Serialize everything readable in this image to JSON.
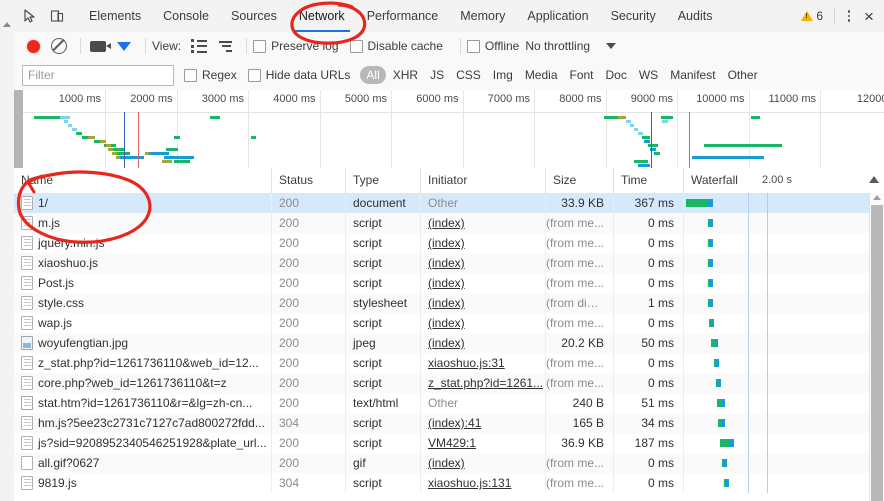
{
  "window": {
    "warning_count": "6",
    "close_label": "×"
  },
  "tabbar": {
    "inspect_icon": "inspect-cursor-icon",
    "device_icon": "device-toolbar-icon",
    "tabs": [
      {
        "label": "Elements",
        "active": false
      },
      {
        "label": "Console",
        "active": false
      },
      {
        "label": "Sources",
        "active": false
      },
      {
        "label": "Network",
        "active": true
      },
      {
        "label": "Performance",
        "active": false
      },
      {
        "label": "Memory",
        "active": false
      },
      {
        "label": "Application",
        "active": false
      },
      {
        "label": "Security",
        "active": false
      },
      {
        "label": "Audits",
        "active": false
      }
    ]
  },
  "toolbar": {
    "record_icon": "record-icon",
    "clear_icon": "clear-icon",
    "camera_icon": "camera-icon",
    "filter_icon": "funnel-icon",
    "view_label": "View:",
    "view_list_icon": "list-view-icon",
    "view_waterfall_icon": "waterfall-view-icon",
    "preserve_log_label": "Preserve log",
    "disable_cache_label": "Disable cache",
    "offline_label": "Offline",
    "throttling_value": "No throttling",
    "throttling_caret_icon": "chevron-down-icon"
  },
  "filterbar": {
    "filter_placeholder": "Filter",
    "filter_value": "",
    "regex_label": "Regex",
    "hide_data_urls_label": "Hide data URLs",
    "types": [
      {
        "label": "All",
        "selected": true
      },
      {
        "label": "XHR",
        "selected": false
      },
      {
        "label": "JS",
        "selected": false
      },
      {
        "label": "CSS",
        "selected": false
      },
      {
        "label": "Img",
        "selected": false
      },
      {
        "label": "Media",
        "selected": false
      },
      {
        "label": "Font",
        "selected": false
      },
      {
        "label": "Doc",
        "selected": false
      },
      {
        "label": "WS",
        "selected": false
      },
      {
        "label": "Manifest",
        "selected": false
      },
      {
        "label": "Other",
        "selected": false
      }
    ]
  },
  "overview": {
    "ticks": [
      "1000 ms",
      "2000 ms",
      "3000 ms",
      "4000 ms",
      "5000 ms",
      "6000 ms",
      "7000 ms",
      "8000 ms",
      "9000 ms",
      "10000 ms",
      "11000 ms",
      "12000"
    ],
    "dom_content_loaded_color": "#3b5fc0",
    "load_color": "#e06060"
  },
  "table": {
    "columns": [
      {
        "label": "Name"
      },
      {
        "label": "Status"
      },
      {
        "label": "Type"
      },
      {
        "label": "Initiator"
      },
      {
        "label": "Size"
      },
      {
        "label": "Time"
      },
      {
        "label": "Waterfall"
      }
    ],
    "waterfall_scale": "2.00 s",
    "rows": [
      {
        "name": "1/",
        "icon": "document-file-icon",
        "status": "200",
        "type": "document",
        "initiator": "Other",
        "initiator_link": false,
        "size": "33.9 KB",
        "size_muted": false,
        "time": "367 ms",
        "selected": true
      },
      {
        "name": "m.js",
        "icon": "script-file-icon",
        "status": "200",
        "type": "script",
        "initiator": "(index)",
        "initiator_link": true,
        "size": "(from me...",
        "size_muted": true,
        "time": "0 ms",
        "selected": false
      },
      {
        "name": "jquery.min.js",
        "icon": "script-file-icon",
        "status": "200",
        "type": "script",
        "initiator": "(index)",
        "initiator_link": true,
        "size": "(from me...",
        "size_muted": true,
        "time": "0 ms",
        "selected": false
      },
      {
        "name": "xiaoshuo.js",
        "icon": "script-file-icon",
        "status": "200",
        "type": "script",
        "initiator": "(index)",
        "initiator_link": true,
        "size": "(from me...",
        "size_muted": true,
        "time": "0 ms",
        "selected": false
      },
      {
        "name": "Post.js",
        "icon": "script-file-icon",
        "status": "200",
        "type": "script",
        "initiator": "(index)",
        "initiator_link": true,
        "size": "(from me...",
        "size_muted": true,
        "time": "0 ms",
        "selected": false
      },
      {
        "name": "style.css",
        "icon": "stylesheet-file-icon",
        "status": "200",
        "type": "stylesheet",
        "initiator": "(index)",
        "initiator_link": true,
        "size": "(from disk...",
        "size_muted": true,
        "time": "1 ms",
        "selected": false
      },
      {
        "name": "wap.js",
        "icon": "script-file-icon",
        "status": "200",
        "type": "script",
        "initiator": "(index)",
        "initiator_link": true,
        "size": "(from me...",
        "size_muted": true,
        "time": "0 ms",
        "selected": false
      },
      {
        "name": "woyufengtian.jpg",
        "icon": "image-file-icon",
        "status": "200",
        "type": "jpeg",
        "initiator": "(index)",
        "initiator_link": true,
        "size": "20.2 KB",
        "size_muted": false,
        "time": "50 ms",
        "selected": false
      },
      {
        "name": "z_stat.php?id=1261736110&web_id=12...",
        "icon": "script-file-icon",
        "status": "200",
        "type": "script",
        "initiator": "xiaoshuo.js:31",
        "initiator_link": true,
        "size": "(from me...",
        "size_muted": true,
        "time": "0 ms",
        "selected": false
      },
      {
        "name": "core.php?web_id=1261736110&t=z",
        "icon": "script-file-icon",
        "status": "200",
        "type": "script",
        "initiator": "z_stat.php?id=1261...",
        "initiator_link": true,
        "size": "(from me...",
        "size_muted": true,
        "time": "0 ms",
        "selected": false
      },
      {
        "name": "stat.htm?id=1261736110&r=&lg=zh-cn...",
        "icon": "frame-file-icon",
        "status": "200",
        "type": "text/html",
        "initiator": "Other",
        "initiator_link": false,
        "size": "240 B",
        "size_muted": false,
        "time": "51 ms",
        "selected": false
      },
      {
        "name": "hm.js?5ee23c2731c7127c7ad800272fdd...",
        "icon": "script-file-icon",
        "status": "304",
        "type": "script",
        "initiator": "(index):41",
        "initiator_link": true,
        "size": "165 B",
        "size_muted": false,
        "time": "34 ms",
        "selected": false
      },
      {
        "name": "js?sid=9208952340546251928&plate_url...",
        "icon": "script-file-icon",
        "status": "200",
        "type": "script",
        "initiator": "VM429:1",
        "initiator_link": true,
        "size": "36.9 KB",
        "size_muted": false,
        "time": "187 ms",
        "selected": false
      },
      {
        "name": "all.gif?0627",
        "icon": "gif-file-icon",
        "status": "200",
        "type": "gif",
        "initiator": "(index)",
        "initiator_link": true,
        "size": "(from me...",
        "size_muted": true,
        "time": "0 ms",
        "selected": false
      },
      {
        "name": "9819.js",
        "icon": "script-file-icon",
        "status": "304",
        "type": "script",
        "initiator": "xiaoshuo.js:131",
        "initiator_link": true,
        "size": "(from me...",
        "size_muted": true,
        "time": "0 ms",
        "selected": false
      }
    ]
  },
  "annotations": {
    "network_tab_circle": "red-ellipse-around-network-tab",
    "name_column_circle": "red-ellipse-around-name-column"
  }
}
